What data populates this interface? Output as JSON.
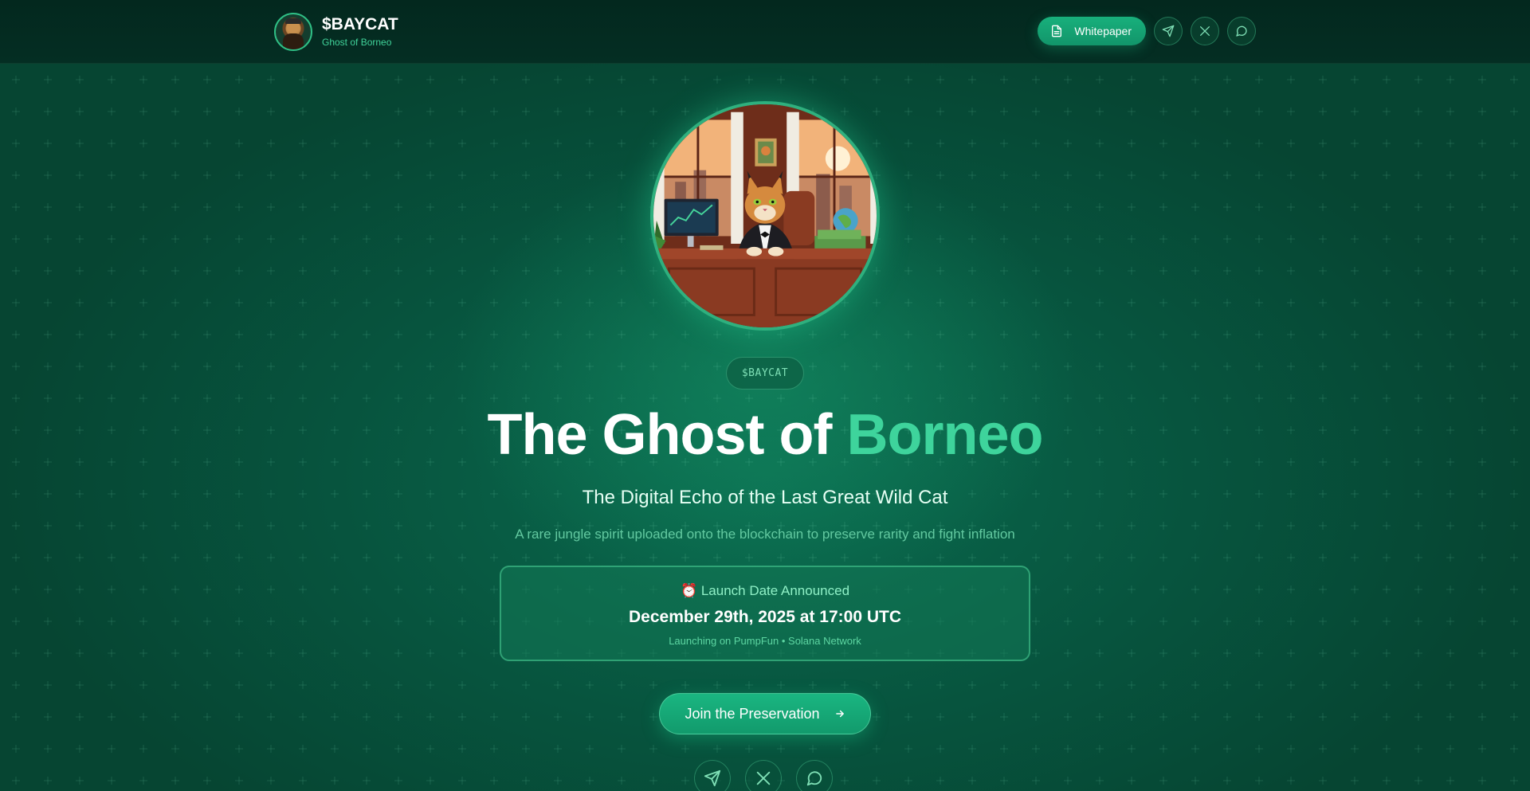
{
  "header": {
    "brand_title": "$BAYCAT",
    "brand_subtitle": "Ghost of Borneo",
    "whitepaper_label": "Whitepaper",
    "social_icons": [
      "telegram-icon",
      "x-icon",
      "chat-icon"
    ]
  },
  "hero": {
    "ticker_tag": "$BAYCAT",
    "headline_main": "The Ghost of",
    "headline_accent": "Borneo",
    "subheadline": "The Digital Echo of the Last Great Wild Cat",
    "description": "A rare jungle spirit uploaded onto the blockchain to preserve rarity and fight inflation",
    "launch": {
      "title": "⏰ Launch Date Announced",
      "date": "December 29th, 2025 at 17:00 UTC",
      "note": "Launching on PumpFun • Solana Network"
    },
    "cta_label": "Join the Preservation"
  },
  "colors": {
    "accent": "#3ed49c",
    "button": "#18b07c",
    "header_bg": "#03281e",
    "page_bg": "#07543e"
  }
}
